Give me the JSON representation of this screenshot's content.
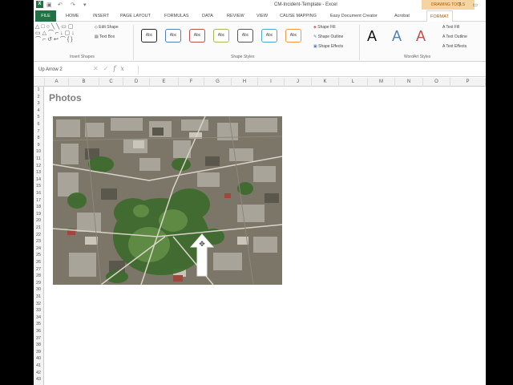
{
  "window": {
    "title": "CM-Incident-Template - Excel",
    "context_tab_group": "DRAWING TOOLS"
  },
  "tabs": [
    "FILE",
    "HOME",
    "INSERT",
    "PAGE LAYOUT",
    "FORMULAS",
    "DATA",
    "REVIEW",
    "VIEW",
    "CAUSE MAPPING",
    "Easy Document Creator",
    "Acrobat",
    "FORMAT"
  ],
  "active_tab": "FORMAT",
  "ribbon": {
    "insert_shapes": {
      "label": "Insert Shapes",
      "edit_shape": "Edit Shape",
      "text_box": "Text Box"
    },
    "shape_styles": {
      "label": "Shape Styles",
      "style_sample": "Abc",
      "style_colors": [
        "#222222",
        "#4f81bd",
        "#c0504d",
        "#9bbb59",
        "#555555",
        "#4bacc6",
        "#f79646"
      ],
      "shape_fill": "Shape Fill",
      "shape_outline": "Shape Outline",
      "shape_effects": "Shape Effects"
    },
    "wordart_styles": {
      "label": "WordArt Styles",
      "letters": [
        "A",
        "A",
        "A"
      ],
      "letter_colors": [
        "#111111",
        "#4f81bd",
        "#c0504d"
      ],
      "text_fill": "Text Fill",
      "text_outline": "Text Outline",
      "text_effects": "Text Effects"
    }
  },
  "formula_bar": {
    "name_box": "Up Arrow 2",
    "fx": "fx",
    "value": ""
  },
  "columns": [
    "A",
    "B",
    "C",
    "D",
    "E",
    "F",
    "G",
    "H",
    "I",
    "J",
    "K",
    "L",
    "M",
    "N",
    "O",
    "P"
  ],
  "rows": [
    "1",
    "2",
    "3",
    "4",
    "5",
    "6",
    "7",
    "8",
    "9",
    "10",
    "11",
    "12",
    "13",
    "14",
    "15",
    "16",
    "17",
    "18",
    "19",
    "20",
    "21",
    "22",
    "23",
    "24",
    "25",
    "26",
    "27",
    "28",
    "29",
    "30",
    "31",
    "32",
    "33",
    "34",
    "35",
    "36",
    "37",
    "38",
    "39",
    "40",
    "41",
    "42",
    "43"
  ],
  "sheet": {
    "heading": "Photos",
    "photo": "aerial city photo",
    "shape": "up-arrow"
  }
}
